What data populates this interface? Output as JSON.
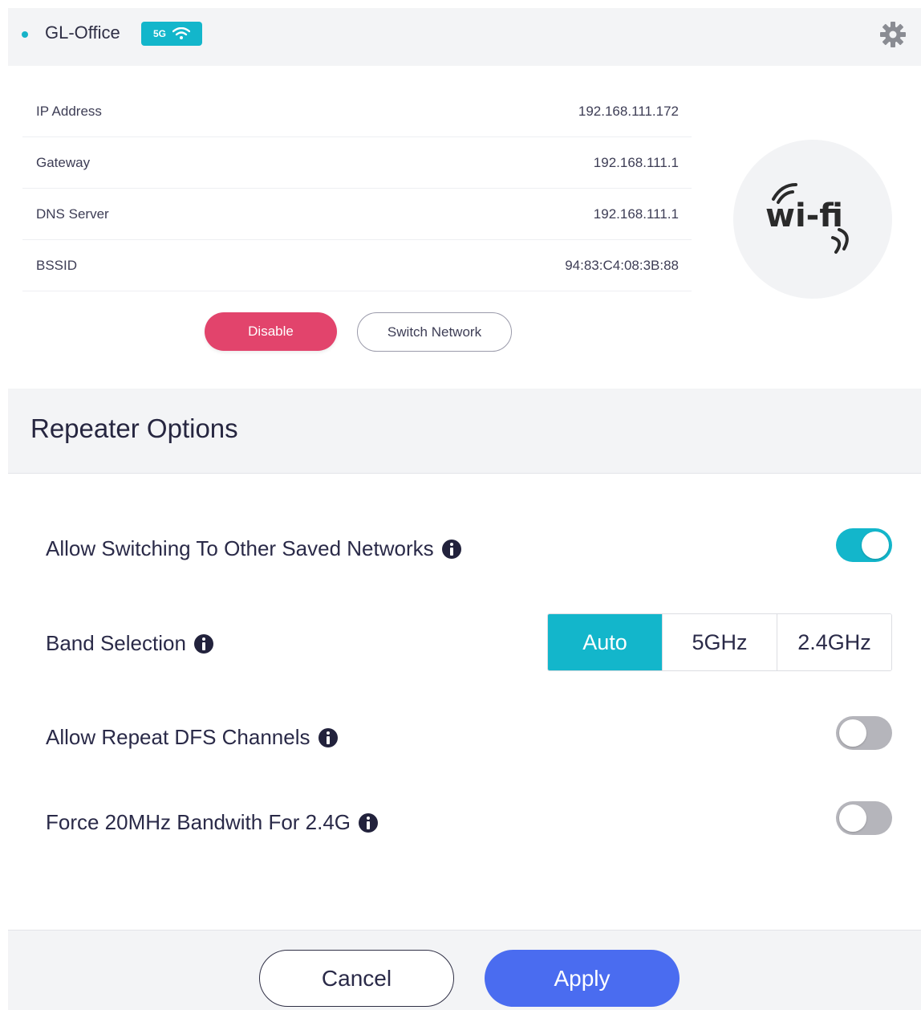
{
  "connection": {
    "ssid": "GL-Office",
    "band_badge": "5G",
    "fields": [
      {
        "label": "IP Address",
        "value": "192.168.111.172"
      },
      {
        "label": "Gateway",
        "value": "192.168.111.1"
      },
      {
        "label": "DNS Server",
        "value": "192.168.111.1"
      },
      {
        "label": "BSSID",
        "value": "94:83:C4:08:3B:88"
      }
    ],
    "wifi_logo_text": "wi-fi",
    "disable_label": "Disable",
    "switch_label": "Switch Network"
  },
  "repeater": {
    "title": "Repeater Options",
    "options": [
      {
        "label": "Allow Switching To Other Saved Networks",
        "enabled": true
      },
      {
        "label": "Band Selection"
      },
      {
        "label": "Allow Repeat DFS Channels",
        "enabled": false
      },
      {
        "label": "Force 20MHz Bandwith For 2.4G",
        "enabled": false
      }
    ],
    "band_options": [
      "Auto",
      "5GHz",
      "2.4GHz"
    ],
    "band_selected": "Auto"
  },
  "footer": {
    "cancel_label": "Cancel",
    "apply_label": "Apply"
  },
  "colors": {
    "accent": "#13b6cb",
    "danger": "#e2446c",
    "primary": "#4a6cf0"
  }
}
